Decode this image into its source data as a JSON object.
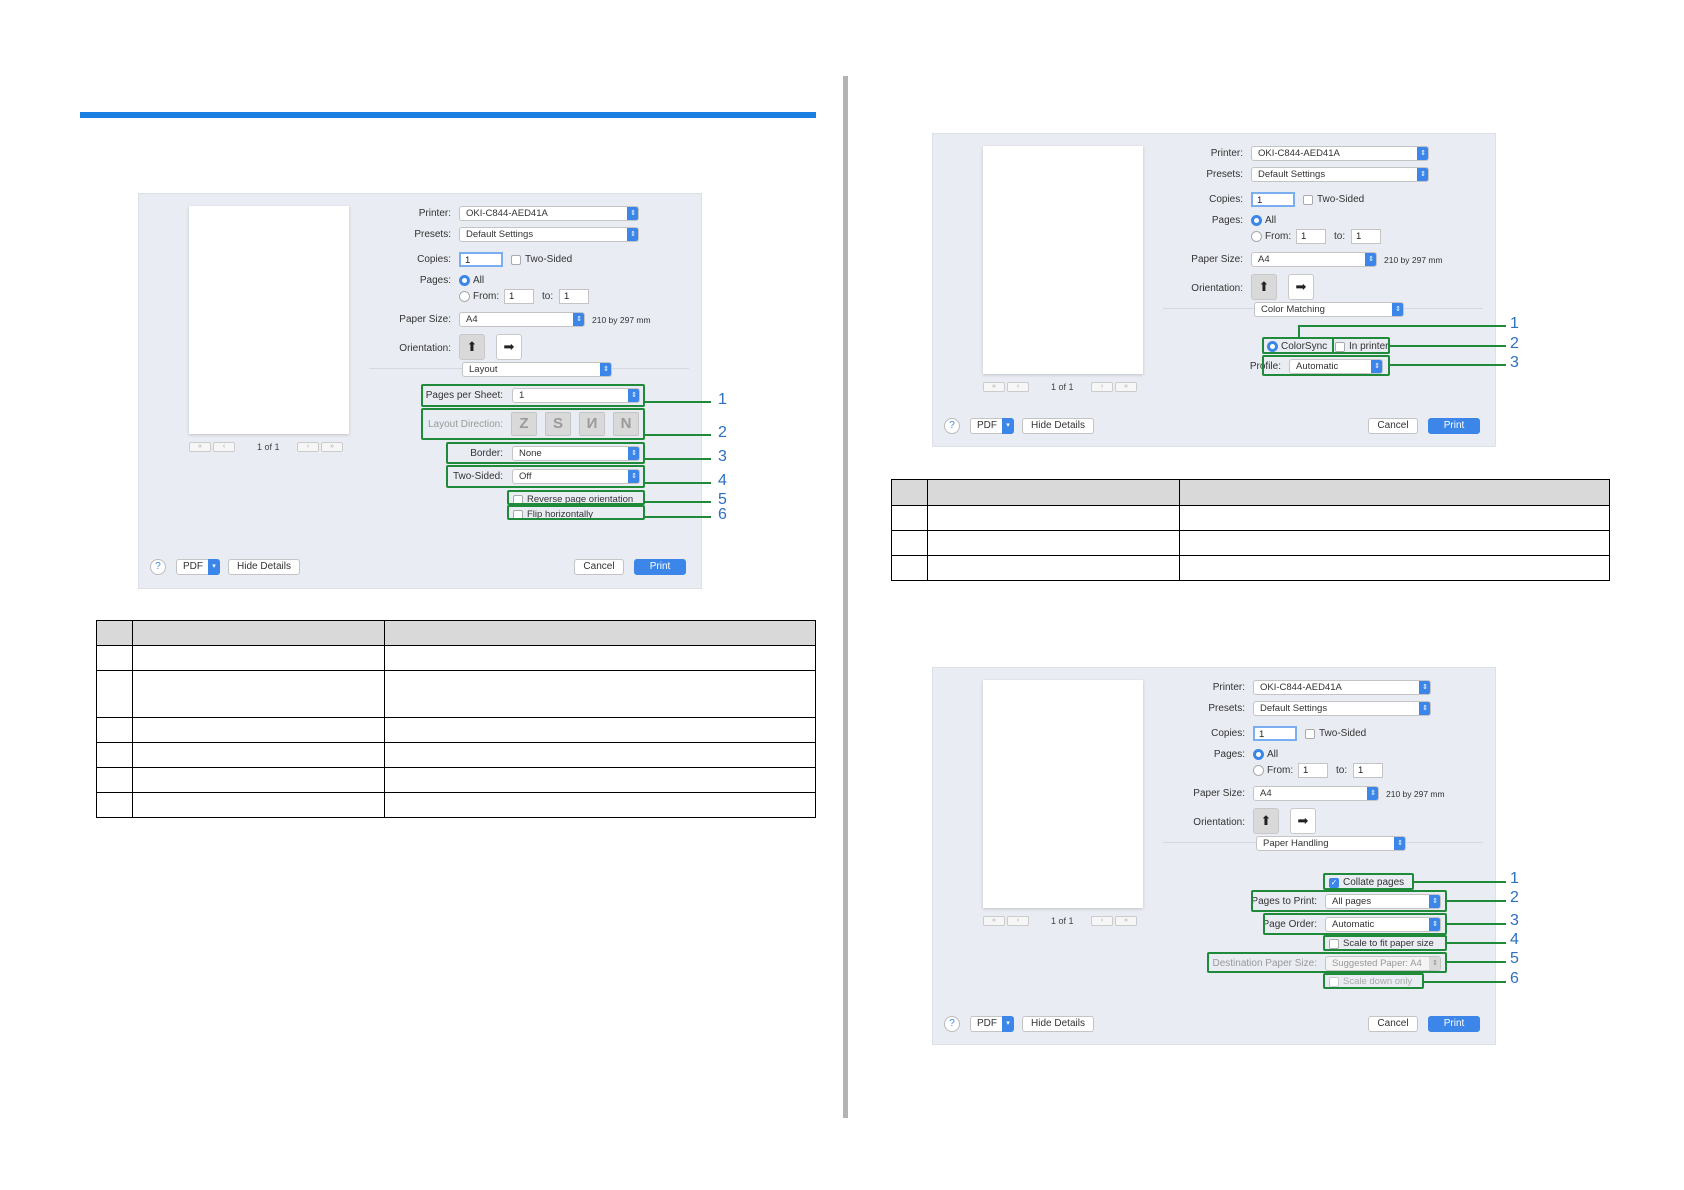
{
  "dialog_common": {
    "printer_label": "Printer:",
    "printer_value": "OKI-C844-AED41A",
    "presets_label": "Presets:",
    "presets_value": "Default Settings",
    "copies_label": "Copies:",
    "copies_value": "1",
    "two_sided_checkbox": "Two-Sided",
    "pages_label": "Pages:",
    "pages_all": "All",
    "pages_from_label": "From:",
    "pages_from_value": "1",
    "pages_to_label": "to:",
    "pages_to_value": "1",
    "paper_size_label": "Paper Size:",
    "paper_size_value": "A4",
    "paper_size_dims": "210 by 297 mm",
    "orientation_label": "Orientation:",
    "page_counter": "1 of 1",
    "pdf_button": "PDF",
    "hide_details_button": "Hide Details",
    "cancel_button": "Cancel",
    "print_button": "Print",
    "help_icon": "?"
  },
  "dialog_layout": {
    "panel_select": "Layout",
    "pages_per_sheet_label": "Pages per Sheet:",
    "pages_per_sheet_value": "1",
    "layout_direction_label": "Layout Direction:",
    "border_label": "Border:",
    "border_value": "None",
    "two_sided_label": "Two-Sided:",
    "two_sided_value": "Off",
    "reverse_page_orientation": "Reverse page orientation",
    "flip_horizontally": "Flip horizontally",
    "callouts": [
      "1",
      "2",
      "3",
      "4",
      "5",
      "6"
    ]
  },
  "dialog_color": {
    "panel_select": "Color Matching",
    "colorsync": "ColorSync",
    "in_printer": "In printer",
    "profile_label": "Profile:",
    "profile_value": "Automatic",
    "callouts": [
      "1",
      "2",
      "3"
    ]
  },
  "dialog_paper": {
    "panel_select": "Paper Handling",
    "collate_pages": "Collate pages",
    "pages_to_print_label": "Pages to Print:",
    "pages_to_print_value": "All pages",
    "page_order_label": "Page Order:",
    "page_order_value": "Automatic",
    "scale_to_fit": "Scale to fit paper size",
    "destination_paper_size_label": "Destination Paper Size:",
    "destination_paper_size_value": "Suggested Paper: A4",
    "scale_down_only": "Scale down only",
    "callouts": [
      "1",
      "2",
      "3",
      "4",
      "5",
      "6"
    ]
  },
  "icons": {
    "portrait": "portrait-orientation-icon",
    "landscape": "landscape-orientation-icon",
    "layout_z": "layout-z-icon",
    "layout_s": "layout-s-icon",
    "layout_n_rev": "layout-reverse-n-icon",
    "layout_n": "layout-n-icon"
  },
  "colors": {
    "accent": "#1a7ee0",
    "callout_box": "#1f8a3a",
    "callout_number": "#2d6fc0",
    "table_header": "#d9d9d9"
  }
}
